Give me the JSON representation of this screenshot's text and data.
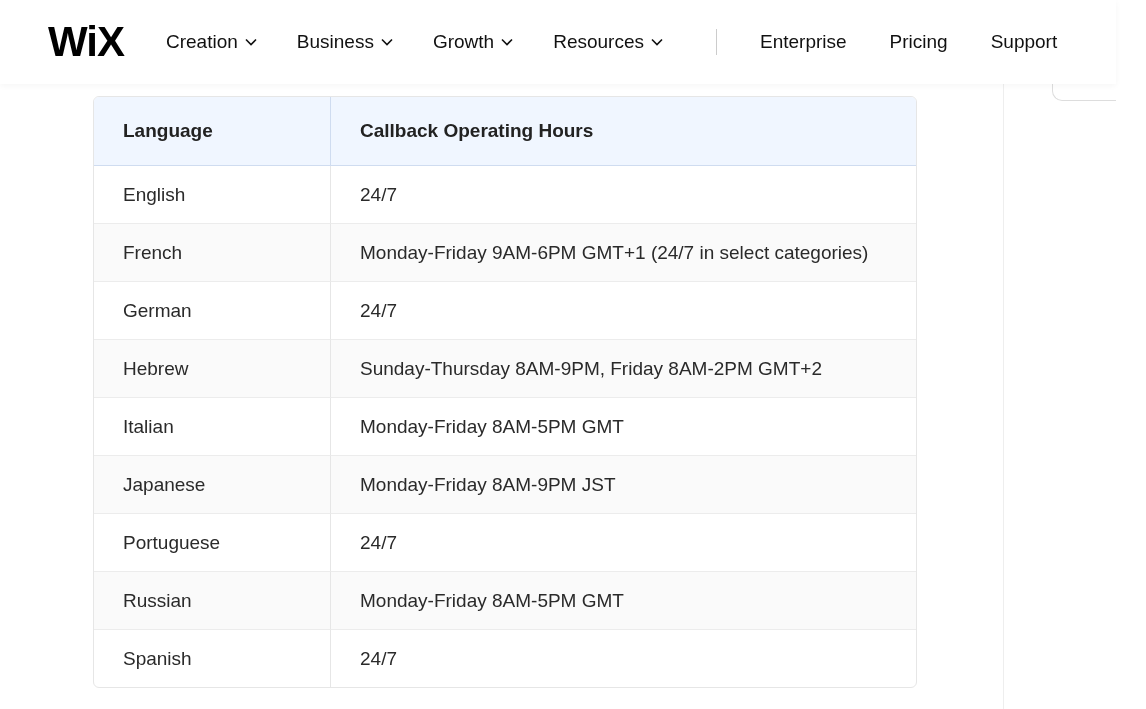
{
  "header": {
    "logo": "WiX",
    "nav": [
      {
        "label": "Creation",
        "dropdown": true
      },
      {
        "label": "Business",
        "dropdown": true
      },
      {
        "label": "Growth",
        "dropdown": true
      },
      {
        "label": "Resources",
        "dropdown": true
      },
      {
        "label": "Enterprise",
        "dropdown": false
      },
      {
        "label": "Pricing",
        "dropdown": false
      },
      {
        "label": "Support",
        "dropdown": false
      }
    ]
  },
  "table": {
    "columns": [
      "Language",
      "Callback Operating Hours"
    ],
    "rows": [
      [
        "English",
        "24/7"
      ],
      [
        "French",
        "Monday-Friday 9AM-6PM GMT+1 (24/7 in select categories)"
      ],
      [
        "German",
        "24/7"
      ],
      [
        "Hebrew",
        "Sunday-Thursday 8AM-9PM, Friday 8AM-2PM GMT+2"
      ],
      [
        "Italian",
        "Monday-Friday 8AM-5PM GMT"
      ],
      [
        "Japanese",
        "Monday-Friday 8AM-9PM JST"
      ],
      [
        "Portuguese",
        "24/7"
      ],
      [
        "Russian",
        "Monday-Friday 8AM-5PM GMT"
      ],
      [
        "Spanish",
        "24/7"
      ]
    ]
  }
}
